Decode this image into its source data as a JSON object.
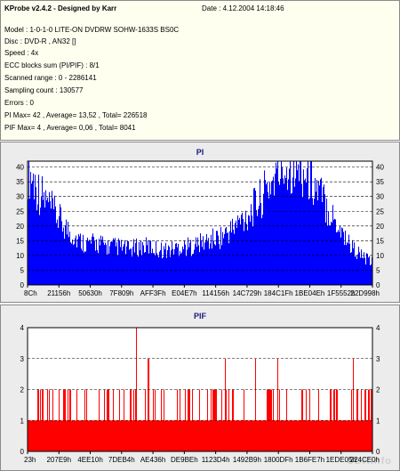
{
  "colors": {
    "pi": "#0000ff",
    "pif": "#ff0000",
    "panel_bg": "#ececec",
    "plot_bg": "#ffffff",
    "info_bg": "#fffff0"
  },
  "header": {
    "title": "KProbe v2.4.2 - Designed by Karr",
    "date": "Date : 4.12.2004 14:18:46"
  },
  "info": {
    "model": "Model : 1-0-1-0 LITE-ON DVDRW SOHW-1633S BS0C",
    "disc": "Disc : DVD-R , AN32 []",
    "speed": "Speed : 4x",
    "ecc": "ECC blocks sum (PI/PIF) : 8/1",
    "range": "Scanned range : 0 - 2286141",
    "sampling": "Sampling count : 130577",
    "errors": "Errors : 0",
    "pi_stats": "PI Max= 42 , Average= 13,52 , Total= 226518",
    "pif_stats": "PIF Max= 4 , Average= 0,06 , Total= 8041"
  },
  "watermark": "CDRinfo",
  "chart_data": [
    {
      "type": "area",
      "title": "PI",
      "ylim": [
        0,
        42
      ],
      "yticks": [
        0,
        5,
        10,
        15,
        20,
        25,
        30,
        35,
        40
      ],
      "xticks": [
        "8Ch",
        "21156h",
        "50630h",
        "7F809h",
        "AFF3Fh",
        "E04E7h",
        "114156h",
        "14C729h",
        "184C1Fh",
        "1BE04Eh",
        "1F5552h",
        "22D998h"
      ],
      "grid": true,
      "series": [
        {
          "values": [
            36,
            30,
            25,
            21,
            17,
            14,
            13,
            13,
            12,
            12,
            11,
            12,
            12,
            11,
            11,
            12,
            12,
            13,
            14,
            15,
            17,
            20,
            23,
            27,
            32,
            36,
            38,
            36,
            33,
            28,
            22,
            17,
            12,
            9,
            7
          ]
        }
      ]
    },
    {
      "type": "area",
      "title": "PIF",
      "ylim": [
        0,
        4
      ],
      "yticks": [
        0,
        1,
        2,
        3,
        4
      ],
      "xticks": [
        "23h",
        "207E9h",
        "4EE10h",
        "7DEB4h",
        "AE436h",
        "DE9BEh",
        "1123D4h",
        "1492B9h",
        "1800DFh",
        "1B6FE7h",
        "1EDE05h",
        "224CE0h"
      ],
      "grid": true,
      "series": [
        {
          "values": [
            1,
            2,
            1,
            1,
            2,
            1,
            1,
            1,
            2,
            1,
            1,
            1,
            1,
            2,
            1,
            1,
            2,
            1,
            1,
            1,
            2,
            1,
            1,
            1,
            2,
            1,
            1,
            1,
            2,
            1,
            2,
            1,
            1,
            2,
            2
          ]
        }
      ]
    }
  ]
}
